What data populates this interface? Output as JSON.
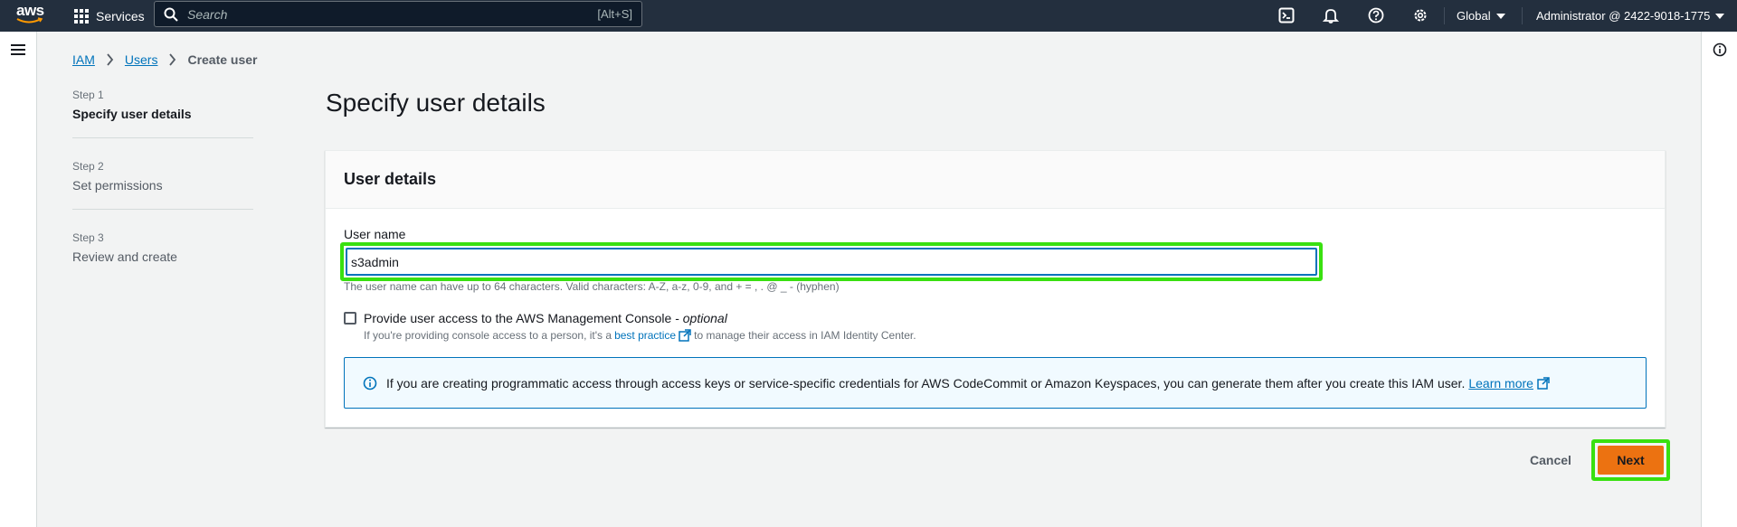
{
  "topnav": {
    "logo_text": "aws",
    "services_label": "Services",
    "search_placeholder": "Search",
    "search_shortcut": "[Alt+S]",
    "region_label": "Global",
    "account_label": "Administrator @ 2422-9018-1775"
  },
  "breadcrumb": {
    "items": [
      "IAM",
      "Users"
    ],
    "current": "Create user"
  },
  "steps": [
    {
      "num": "Step 1",
      "title": "Specify user details"
    },
    {
      "num": "Step 2",
      "title": "Set permissions"
    },
    {
      "num": "Step 3",
      "title": "Review and create"
    }
  ],
  "main": {
    "page_title": "Specify user details",
    "card_title": "User details",
    "username_label": "User name",
    "username_value": "s3admin",
    "username_hint": "The user name can have up to 64 characters. Valid characters: A-Z, a-z, 0-9, and + = , . @ _ - (hyphen)",
    "console_access_label": "Provide user access to the AWS Management Console - ",
    "console_access_optional": "optional",
    "console_sub_prefix": "If you're providing console access to a person, it's a",
    "console_sub_link": "best practice",
    "console_sub_suffix": "to manage their access in IAM Identity Center.",
    "alert_text": "If you are creating programmatic access through access keys or service-specific credentials for AWS CodeCommit or Amazon Keyspaces, you can generate them after you create this IAM user.",
    "alert_link": "Learn more"
  },
  "footer": {
    "cancel_label": "Cancel",
    "next_label": "Next"
  },
  "colors": {
    "nav_bg": "#232f3e",
    "link": "#0073bb",
    "primary_button": "#ec7211",
    "highlight": "#39e010"
  }
}
